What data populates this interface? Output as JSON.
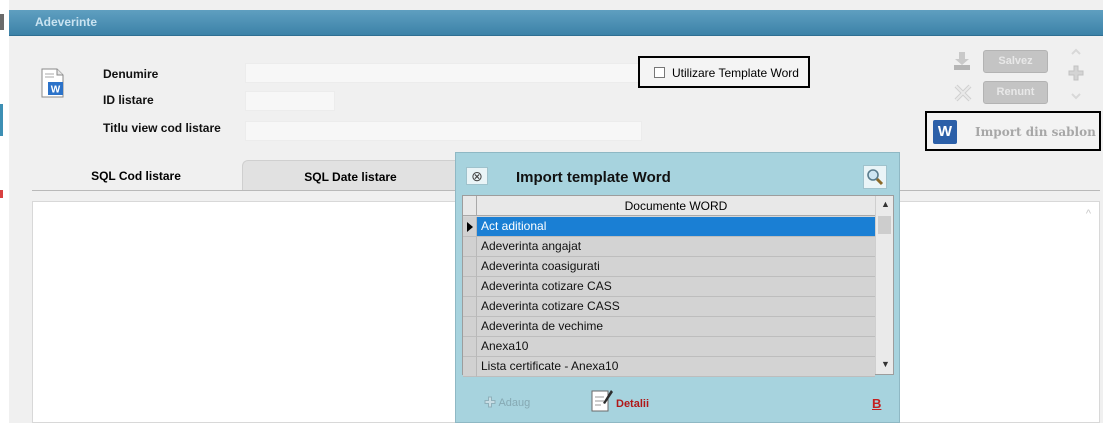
{
  "window": {
    "title": "Adeverinte"
  },
  "form": {
    "denumire_label": "Denumire",
    "id_label": "ID listare",
    "titlu_label": "Titlu view cod listare",
    "denumire_value": "",
    "id_value": "",
    "titlu_value": ""
  },
  "template_checkbox": {
    "label": "Utilizare Template Word",
    "checked": false
  },
  "buttons": {
    "save": "Salvez",
    "cancel": "Renunt",
    "import": "Import din sablon"
  },
  "tabs": [
    {
      "label": "SQL Cod listare"
    },
    {
      "label": "SQL Date listare"
    }
  ],
  "dialog": {
    "title": "Import template Word",
    "column_header": "Documente WORD",
    "items": [
      "Act aditional",
      "Adeverinta angajat",
      "Adeverinta coasigurati",
      "Adeverinta cotizare  CAS",
      "Adeverinta cotizare CASS",
      "Adeverinta de vechime",
      "Anexa10",
      "Lista certificate - Anexa10"
    ],
    "selected_index": 0,
    "add_label": "Adaug",
    "details_label": "Detalii",
    "b_label": "B"
  },
  "colors": {
    "titlebar": "#3c82a8",
    "dialog_bg": "#a7d3de",
    "selection": "#1a7fd4",
    "accent_red": "#c41f1f"
  },
  "icons": [
    "word-document-icon",
    "close-icon",
    "search-icon",
    "add-icon",
    "edit-icon",
    "word-logo-icon",
    "save-tray-icon",
    "cancel-x-icon"
  ]
}
